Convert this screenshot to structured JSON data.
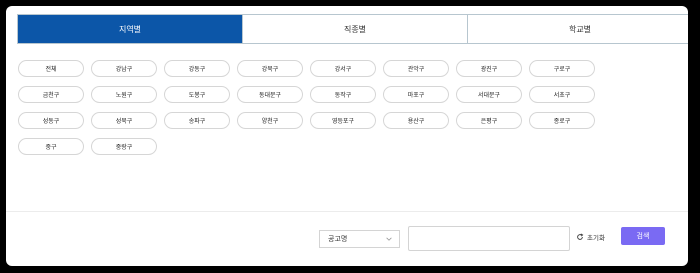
{
  "tabs": [
    {
      "label": "지역별",
      "active": true
    },
    {
      "label": "직종별",
      "active": false
    },
    {
      "label": "학교별",
      "active": false
    }
  ],
  "regions": [
    "전체",
    "강남구",
    "강동구",
    "강북구",
    "강서구",
    "관악구",
    "광진구",
    "구로구",
    "금천구",
    "노원구",
    "도봉구",
    "동대문구",
    "동작구",
    "마포구",
    "서대문구",
    "서초구",
    "성동구",
    "성북구",
    "송파구",
    "양천구",
    "영등포구",
    "용산구",
    "은평구",
    "종로구",
    "중구",
    "중랑구"
  ],
  "search": {
    "select_value": "공고명",
    "input_value": "",
    "reset_label": "초기화",
    "submit_label": "검색"
  },
  "colors": {
    "active_tab": "#0c56a8",
    "search_button": "#7a6af3"
  }
}
